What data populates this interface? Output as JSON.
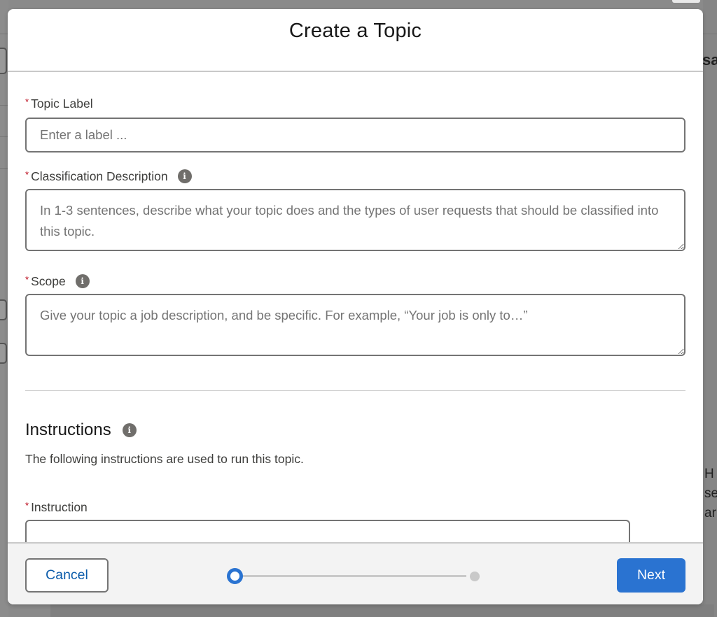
{
  "background": {
    "right_title_fragment": "sa",
    "right_text_fragment": "H\nse\nar"
  },
  "modal": {
    "title": "Create a Topic",
    "fields": {
      "topic_label": {
        "label": "Topic Label",
        "required_marker": "*",
        "value": "",
        "placeholder": "Enter a label ..."
      },
      "classification_description": {
        "label": "Classification Description",
        "required_marker": "*",
        "value": "",
        "placeholder": "In 1-3 sentences, describe what your topic does and the types of user requests that should be classified into this topic."
      },
      "scope": {
        "label": "Scope",
        "required_marker": "*",
        "value": "",
        "placeholder": "Give your topic a job description, and be specific. For example, “Your job is only to…”"
      }
    },
    "instructions": {
      "title": "Instructions",
      "description": "The following instructions are used to run this topic.",
      "instruction_field": {
        "label": "Instruction",
        "required_marker": "*",
        "value": ""
      }
    },
    "info_icon_glyph": "i",
    "footer": {
      "cancel_label": "Cancel",
      "next_label": "Next",
      "progress": {
        "current_step": 1,
        "total_steps": 2
      }
    }
  },
  "colors": {
    "brand_blue": "#2a73d1",
    "link_blue": "#0b5cab",
    "required_red": "#ba0517"
  }
}
